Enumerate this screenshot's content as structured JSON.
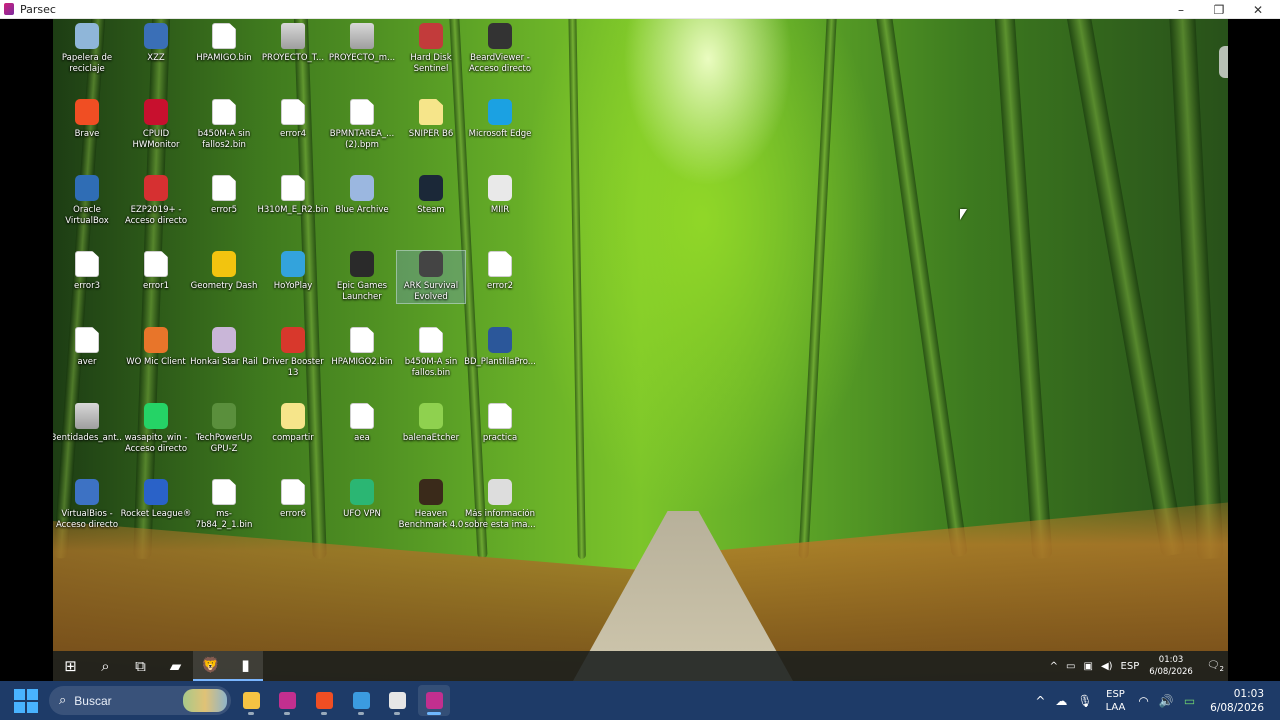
{
  "window": {
    "title": "Parsec",
    "controls": {
      "minimize": "–",
      "maximize": "❐",
      "close": "✕"
    }
  },
  "desktop": {
    "icons": [
      {
        "label": "Papelera de reciclaje",
        "icon": "recycle-bin-icon",
        "color": "#8fb6d9"
      },
      {
        "label": "XZZ",
        "icon": "xzz-app-icon",
        "color": "#3a6fb7"
      },
      {
        "label": "HPAMIGO.bin",
        "icon": "file-icon",
        "color": "#ffffff"
      },
      {
        "label": "PROYECTO_T...",
        "icon": "file-icon",
        "color": "#cccccc"
      },
      {
        "label": "PROYECTO_m...",
        "icon": "file-icon",
        "color": "#cccccc"
      },
      {
        "label": "Hard Disk Sentinel",
        "icon": "hard-disk-sentinel-icon",
        "color": "#c23b3b"
      },
      {
        "label": "BeardViewer - Acceso directo",
        "icon": "shuffle-icon",
        "color": "#333333"
      },
      {
        "label": "Brave",
        "icon": "brave-icon",
        "color": "#f04e23"
      },
      {
        "label": "CPUID HWMonitor",
        "icon": "hwmonitor-icon",
        "color": "#c8102e"
      },
      {
        "label": "b450M-A sin fallos2.bin",
        "icon": "file-icon",
        "color": "#ffffff"
      },
      {
        "label": "error4",
        "icon": "file-icon",
        "color": "#ffffff"
      },
      {
        "label": "BPMNTAREA_... (2).bpm",
        "icon": "file-icon",
        "color": "#ffffff"
      },
      {
        "label": "SNIPER B6",
        "icon": "file-icon",
        "color": "#f6e58a"
      },
      {
        "label": "Microsoft Edge",
        "icon": "edge-icon",
        "color": "#1ba1e2"
      },
      {
        "label": "Oracle VirtualBox",
        "icon": "virtualbox-icon",
        "color": "#2f6db5"
      },
      {
        "label": "EZP2019+ - Acceso directo",
        "icon": "ezp-icon",
        "color": "#d63031"
      },
      {
        "label": "error5",
        "icon": "file-icon",
        "color": "#ffffff"
      },
      {
        "label": "H310M_E_R2.bin",
        "icon": "file-icon",
        "color": "#ffffff"
      },
      {
        "label": "Blue Archive",
        "icon": "blue-archive-icon",
        "color": "#9bb7e0"
      },
      {
        "label": "Steam",
        "icon": "steam-icon",
        "color": "#1b2838"
      },
      {
        "label": "MIIR",
        "icon": "miir-icon",
        "color": "#e9e9e9"
      },
      {
        "label": "error3",
        "icon": "file-icon",
        "color": "#ffffff"
      },
      {
        "label": "error1",
        "icon": "file-icon",
        "color": "#ffffff"
      },
      {
        "label": "Geometry Dash",
        "icon": "geometry-dash-icon",
        "color": "#f2c40f"
      },
      {
        "label": "HoYoPlay",
        "icon": "hoyoplay-icon",
        "color": "#33a3dc"
      },
      {
        "label": "Epic Games Launcher",
        "icon": "epic-games-icon",
        "color": "#2a2a2a"
      },
      {
        "label": "ARK Survival Evolved",
        "icon": "ark-icon",
        "color": "#444444"
      },
      {
        "label": "error2",
        "icon": "file-icon",
        "color": "#ffffff"
      },
      {
        "label": "aver",
        "icon": "file-icon",
        "color": "#ffffff"
      },
      {
        "label": "WO Mic Client",
        "icon": "microphone-icon",
        "color": "#e8752a"
      },
      {
        "label": "Honkai Star Rail",
        "icon": "honkai-icon",
        "color": "#c9b6d8"
      },
      {
        "label": "Driver Booster 13",
        "icon": "driver-booster-icon",
        "color": "#d8382c"
      },
      {
        "label": "HPAMIGO2.bin",
        "icon": "file-icon",
        "color": "#ffffff"
      },
      {
        "label": "b450M-A sin fallos.bin",
        "icon": "file-icon",
        "color": "#ffffff"
      },
      {
        "label": "BD_PlantillaPro...",
        "icon": "word-doc-icon",
        "color": "#2b579a"
      },
      {
        "label": "3entidades_ant...",
        "icon": "file-icon",
        "color": "#cccccc"
      },
      {
        "label": "wasapito_win - Acceso directo",
        "icon": "whatsapp-icon",
        "color": "#25d366"
      },
      {
        "label": "TechPowerUp GPU-Z",
        "icon": "gpu-z-icon",
        "color": "#5a8f3c"
      },
      {
        "label": "compartir",
        "icon": "share-file-icon",
        "color": "#f6e58a"
      },
      {
        "label": "aea",
        "icon": "file-icon",
        "color": "#ffffff"
      },
      {
        "label": "balenaEtcher",
        "icon": "balena-etcher-icon",
        "color": "#8fd14f"
      },
      {
        "label": "practica",
        "icon": "file-icon",
        "color": "#f5f5f5"
      },
      {
        "label": "VirtualBios - Acceso directo",
        "icon": "virtualbios-icon",
        "color": "#3d72c4"
      },
      {
        "label": "Rocket League®",
        "icon": "rocket-league-icon",
        "color": "#2a62c8"
      },
      {
        "label": "ms-7b84_2_1.bin",
        "icon": "file-icon",
        "color": "#ffffff"
      },
      {
        "label": "error6",
        "icon": "file-icon",
        "color": "#ffffff"
      },
      {
        "label": "UFO VPN",
        "icon": "ufo-vpn-icon",
        "color": "#2bb673"
      },
      {
        "label": "Heaven Benchmark 4.0",
        "icon": "heaven-benchmark-icon",
        "color": "#3a2a1a"
      },
      {
        "label": "Más información sobre esta ima...",
        "icon": "camera-icon",
        "color": "#dddddd"
      }
    ]
  },
  "remote_taskbar": {
    "pinned": [
      {
        "icon": "windows-start-icon",
        "glyph": "⊞"
      },
      {
        "icon": "search-icon",
        "glyph": "⌕"
      },
      {
        "icon": "task-view-icon",
        "glyph": "⧉"
      },
      {
        "icon": "file-explorer-icon",
        "glyph": "▰"
      },
      {
        "icon": "brave-icon",
        "glyph": "🦁"
      },
      {
        "icon": "parsec-icon",
        "glyph": "▮"
      }
    ],
    "tray": {
      "chevron": "^",
      "language": "ESP",
      "time": "01:03",
      "date": "6/08/2026",
      "notification_count": "2"
    }
  },
  "local_taskbar": {
    "search_placeholder": "Buscar",
    "apps": [
      {
        "icon": "file-explorer-icon",
        "color": "#f6c343"
      },
      {
        "icon": "parsec-icon",
        "color": "#c22f8f"
      },
      {
        "icon": "brave-icon",
        "color": "#f04e23"
      },
      {
        "icon": "photos-icon",
        "color": "#3b9be0"
      },
      {
        "icon": "obs-icon",
        "color": "#e6e6e6"
      },
      {
        "icon": "parsec-icon",
        "color": "#c22f8f"
      }
    ],
    "tray": {
      "chevron": "^",
      "language_line1": "ESP",
      "language_line2": "LAA",
      "time": "01:03",
      "date": "6/08/2026"
    }
  }
}
